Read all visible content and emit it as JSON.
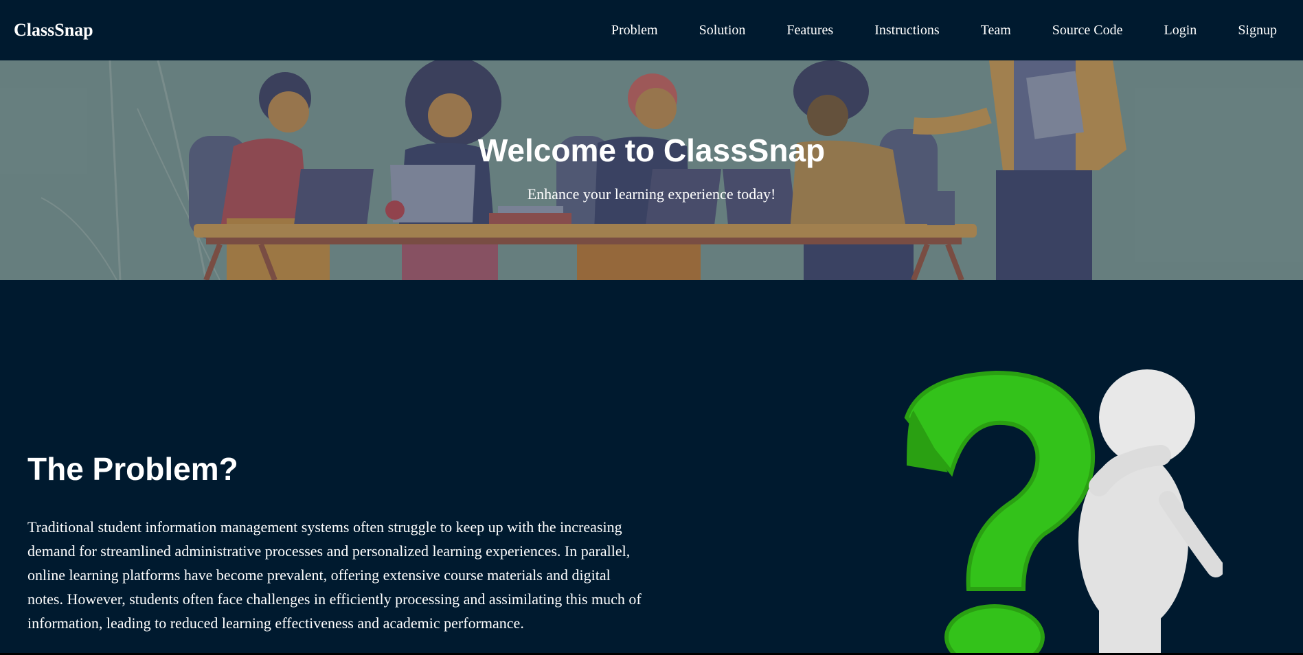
{
  "nav": {
    "brand": "ClassSnap",
    "links": [
      "Problem",
      "Solution",
      "Features",
      "Instructions",
      "Team",
      "Source Code",
      "Login",
      "Signup"
    ]
  },
  "hero": {
    "title": "Welcome to ClassSnap",
    "subtitle": "Enhance your learning experience today!"
  },
  "problem": {
    "title": "The Problem?",
    "body": "Traditional student information management systems often struggle to keep up with the increasing demand for streamlined administrative processes and personalized learning experiences. In parallel, online learning platforms have become prevalent, offering extensive course materials and digital notes. However, students often face challenges in efficiently processing and assimilating this much of information, leading to reduced learning effectiveness and academic performance."
  },
  "colors": {
    "background": "#001a2f",
    "hero_tint": "#6e8585",
    "question_mark": "#33c21a"
  },
  "icons": {
    "hero_image": "students-at-desk-illustration",
    "problem_image": "thinking-figure-question-mark"
  }
}
